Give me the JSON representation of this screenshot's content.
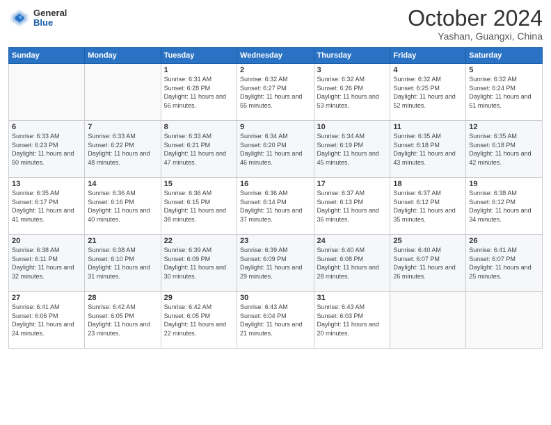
{
  "header": {
    "logo": {
      "general": "General",
      "blue": "Blue"
    },
    "title": "October 2024",
    "location": "Yashan, Guangxi, China"
  },
  "weekdays": [
    "Sunday",
    "Monday",
    "Tuesday",
    "Wednesday",
    "Thursday",
    "Friday",
    "Saturday"
  ],
  "weeks": [
    [
      {
        "day": "",
        "info": ""
      },
      {
        "day": "",
        "info": ""
      },
      {
        "day": "1",
        "info": "Sunrise: 6:31 AM\nSunset: 6:28 PM\nDaylight: 11 hours and 56 minutes."
      },
      {
        "day": "2",
        "info": "Sunrise: 6:32 AM\nSunset: 6:27 PM\nDaylight: 11 hours and 55 minutes."
      },
      {
        "day": "3",
        "info": "Sunrise: 6:32 AM\nSunset: 6:26 PM\nDaylight: 11 hours and 53 minutes."
      },
      {
        "day": "4",
        "info": "Sunrise: 6:32 AM\nSunset: 6:25 PM\nDaylight: 11 hours and 52 minutes."
      },
      {
        "day": "5",
        "info": "Sunrise: 6:32 AM\nSunset: 6:24 PM\nDaylight: 11 hours and 51 minutes."
      }
    ],
    [
      {
        "day": "6",
        "info": "Sunrise: 6:33 AM\nSunset: 6:23 PM\nDaylight: 11 hours and 50 minutes."
      },
      {
        "day": "7",
        "info": "Sunrise: 6:33 AM\nSunset: 6:22 PM\nDaylight: 11 hours and 48 minutes."
      },
      {
        "day": "8",
        "info": "Sunrise: 6:33 AM\nSunset: 6:21 PM\nDaylight: 11 hours and 47 minutes."
      },
      {
        "day": "9",
        "info": "Sunrise: 6:34 AM\nSunset: 6:20 PM\nDaylight: 11 hours and 46 minutes."
      },
      {
        "day": "10",
        "info": "Sunrise: 6:34 AM\nSunset: 6:19 PM\nDaylight: 11 hours and 45 minutes."
      },
      {
        "day": "11",
        "info": "Sunrise: 6:35 AM\nSunset: 6:18 PM\nDaylight: 11 hours and 43 minutes."
      },
      {
        "day": "12",
        "info": "Sunrise: 6:35 AM\nSunset: 6:18 PM\nDaylight: 11 hours and 42 minutes."
      }
    ],
    [
      {
        "day": "13",
        "info": "Sunrise: 6:35 AM\nSunset: 6:17 PM\nDaylight: 11 hours and 41 minutes."
      },
      {
        "day": "14",
        "info": "Sunrise: 6:36 AM\nSunset: 6:16 PM\nDaylight: 11 hours and 40 minutes."
      },
      {
        "day": "15",
        "info": "Sunrise: 6:36 AM\nSunset: 6:15 PM\nDaylight: 11 hours and 38 minutes."
      },
      {
        "day": "16",
        "info": "Sunrise: 6:36 AM\nSunset: 6:14 PM\nDaylight: 11 hours and 37 minutes."
      },
      {
        "day": "17",
        "info": "Sunrise: 6:37 AM\nSunset: 6:13 PM\nDaylight: 11 hours and 36 minutes."
      },
      {
        "day": "18",
        "info": "Sunrise: 6:37 AM\nSunset: 6:12 PM\nDaylight: 11 hours and 35 minutes."
      },
      {
        "day": "19",
        "info": "Sunrise: 6:38 AM\nSunset: 6:12 PM\nDaylight: 11 hours and 34 minutes."
      }
    ],
    [
      {
        "day": "20",
        "info": "Sunrise: 6:38 AM\nSunset: 6:11 PM\nDaylight: 11 hours and 32 minutes."
      },
      {
        "day": "21",
        "info": "Sunrise: 6:38 AM\nSunset: 6:10 PM\nDaylight: 11 hours and 31 minutes."
      },
      {
        "day": "22",
        "info": "Sunrise: 6:39 AM\nSunset: 6:09 PM\nDaylight: 11 hours and 30 minutes."
      },
      {
        "day": "23",
        "info": "Sunrise: 6:39 AM\nSunset: 6:09 PM\nDaylight: 11 hours and 29 minutes."
      },
      {
        "day": "24",
        "info": "Sunrise: 6:40 AM\nSunset: 6:08 PM\nDaylight: 11 hours and 28 minutes."
      },
      {
        "day": "25",
        "info": "Sunrise: 6:40 AM\nSunset: 6:07 PM\nDaylight: 11 hours and 26 minutes."
      },
      {
        "day": "26",
        "info": "Sunrise: 6:41 AM\nSunset: 6:07 PM\nDaylight: 11 hours and 25 minutes."
      }
    ],
    [
      {
        "day": "27",
        "info": "Sunrise: 6:41 AM\nSunset: 6:06 PM\nDaylight: 11 hours and 24 minutes."
      },
      {
        "day": "28",
        "info": "Sunrise: 6:42 AM\nSunset: 6:05 PM\nDaylight: 11 hours and 23 minutes."
      },
      {
        "day": "29",
        "info": "Sunrise: 6:42 AM\nSunset: 6:05 PM\nDaylight: 11 hours and 22 minutes."
      },
      {
        "day": "30",
        "info": "Sunrise: 6:43 AM\nSunset: 6:04 PM\nDaylight: 11 hours and 21 minutes."
      },
      {
        "day": "31",
        "info": "Sunrise: 6:43 AM\nSunset: 6:03 PM\nDaylight: 11 hours and 20 minutes."
      },
      {
        "day": "",
        "info": ""
      },
      {
        "day": "",
        "info": ""
      }
    ]
  ]
}
